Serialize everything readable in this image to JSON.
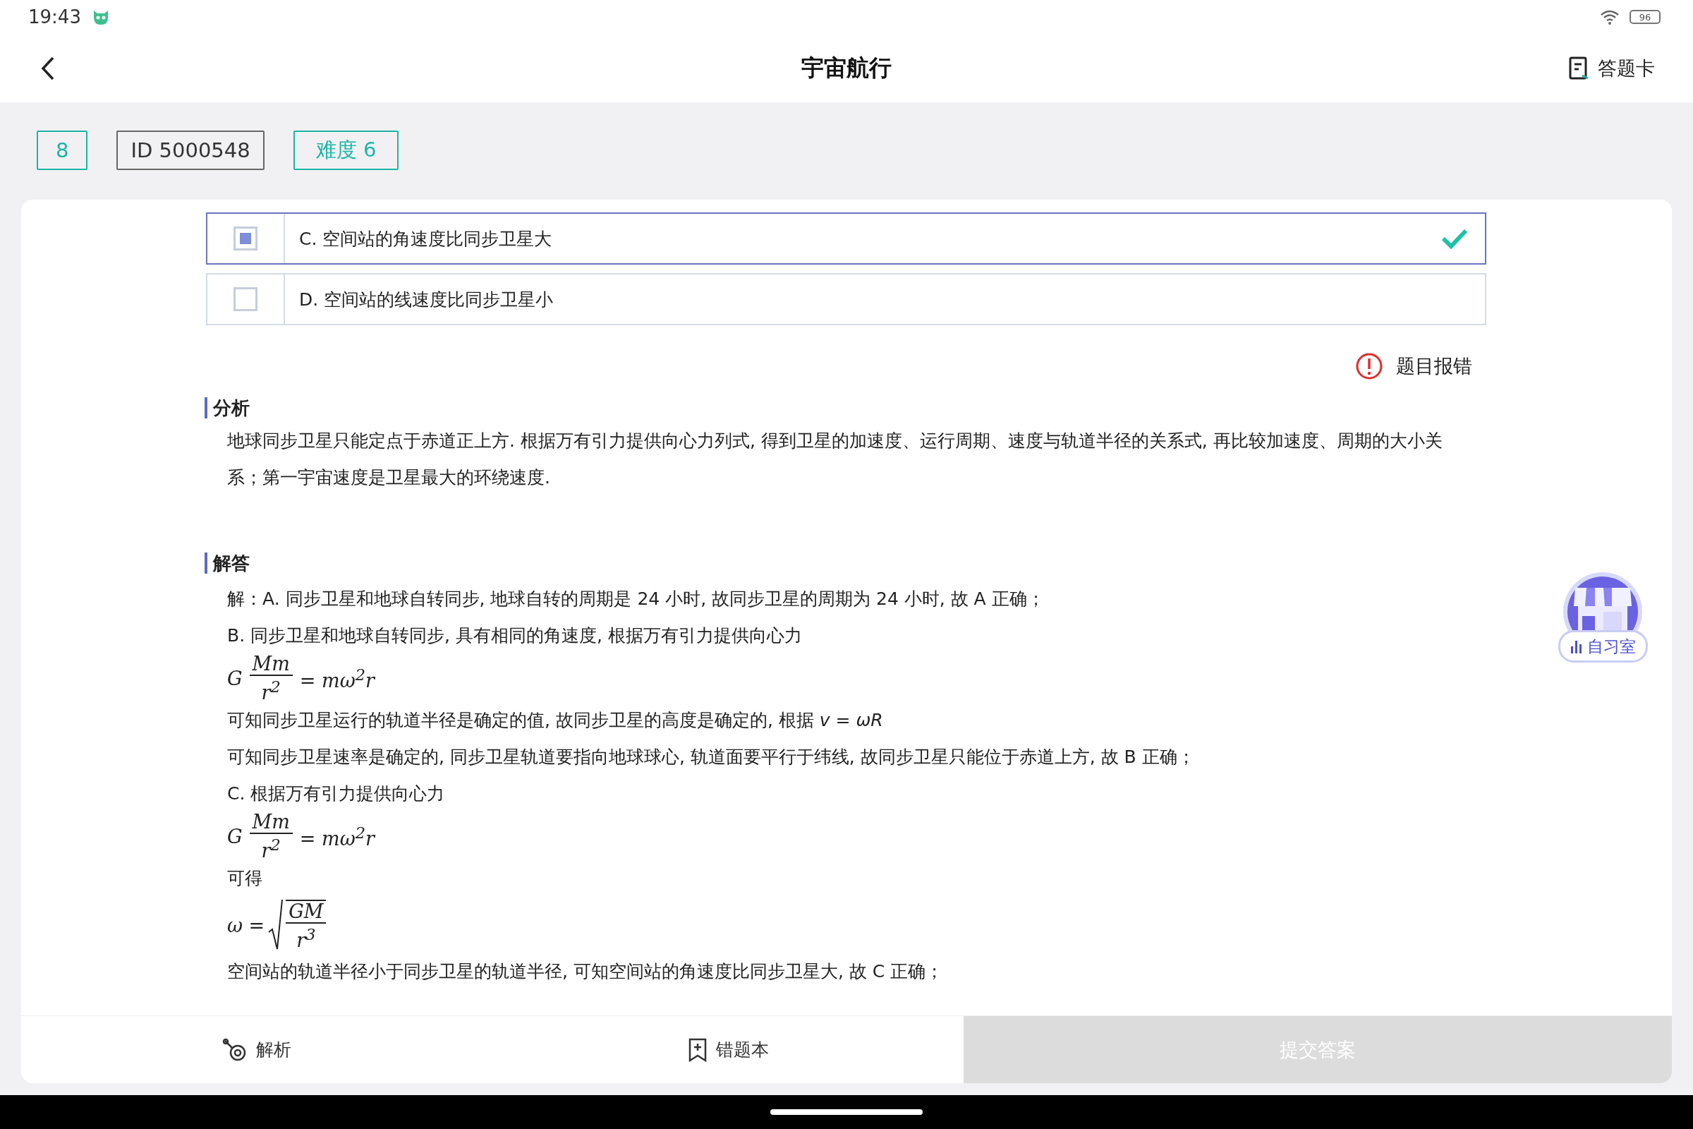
{
  "status_bar": {
    "time": "19:43",
    "battery": "96"
  },
  "header": {
    "title": "宇宙航行",
    "answer_card": "答题卡"
  },
  "tags": [
    {
      "kind": "number",
      "text": "8"
    },
    {
      "kind": "id",
      "text": "ID 5000548"
    },
    {
      "kind": "difficulty",
      "text": "难度 6"
    }
  ],
  "options": [
    {
      "text": "C. 空间站的角速度比同步卫星大",
      "selected": true,
      "correct": true
    },
    {
      "text": "D. 空间站的线速度比同步卫星小",
      "selected": false,
      "correct": false
    }
  ],
  "report_error": "题目报错",
  "sections": [
    {
      "title": "分析",
      "lines": [
        {
          "kind": "text",
          "text": "地球同步卫星只能定点于赤道正上方. 根据万有引力提供向心力列式, 得到卫星的加速度、运行周期、速度与轨道半径的关系式, 再比较加速度、周期的大小关系；第一宇宙速度是卫星最大的环绕速度."
        }
      ]
    },
    {
      "title": "解答",
      "lines": [
        {
          "kind": "text",
          "text": "解：A. 同步卫星和地球自转同步, 地球自转的周期是 24 小时, 故同步卫星的周期为 24 小时, 故 A 正确；"
        },
        {
          "kind": "text",
          "text": "B. 同步卫星和地球自转同步, 具有相同的角速度, 根据万有引力提供向心力"
        },
        {
          "kind": "fraction",
          "lhs": "G",
          "numerator": "Mm",
          "denominator": "r$^{2}$",
          "rhs": "= mω$^{2}$r"
        },
        {
          "kind": "text",
          "text": "可知同步卫星运行的轨道半径是确定的值, 故同步卫星的高度是确定的, 根据 *v* = *ωR*"
        },
        {
          "kind": "text",
          "text": "可知同步卫星速率是确定的, 同步卫星轨道要指向地球球心, 轨道面要平行于纬线, 故同步卫星只能位于赤道上方, 故 B 正确；"
        },
        {
          "kind": "text",
          "text": "C. 根据万有引力提供向心力"
        },
        {
          "kind": "fraction",
          "lhs": "G",
          "numerator": "Mm",
          "denominator": "r$^{2}$",
          "rhs": "= mω$^{2}$r"
        },
        {
          "kind": "text",
          "text": "可得"
        },
        {
          "kind": "sqrt",
          "lhs": "ω =",
          "numerator": "GM",
          "denominator": "r$^{3}$"
        },
        {
          "kind": "text",
          "text": "空间站的轨道半径小于同步卫星的轨道半径, 可知空间站的角速度比同步卫星大, 故 C 正确；"
        }
      ]
    }
  ],
  "floating": {
    "label": "自习室"
  },
  "bottom_bar": {
    "tools": [
      {
        "kind": "analysis",
        "label": "解析"
      },
      {
        "kind": "wrong_book",
        "label": "错题本"
      }
    ],
    "submit": {
      "label": "提交答案",
      "disabled": true
    }
  }
}
